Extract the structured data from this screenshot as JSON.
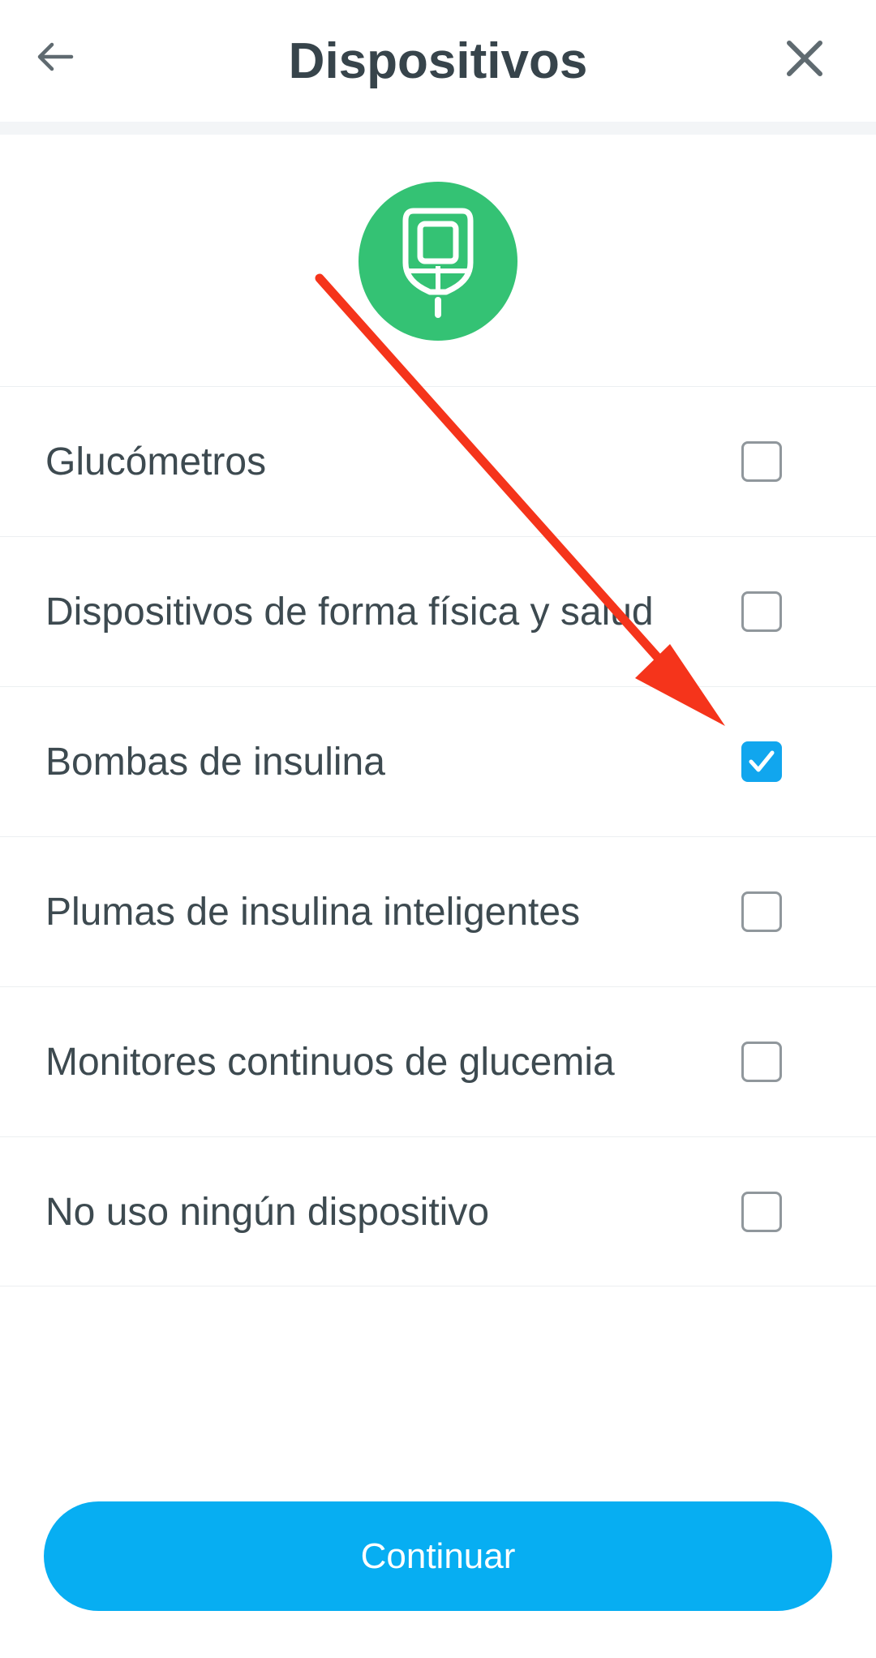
{
  "header": {
    "title": "Dispositivos",
    "back_icon": "arrow-left-icon",
    "close_icon": "close-icon"
  },
  "hero_icon": "glucometer-icon",
  "options": [
    {
      "label": "Glucómetros",
      "checked": false
    },
    {
      "label": "Dispositivos de forma física y salud",
      "checked": false
    },
    {
      "label": "Bombas de insulina",
      "checked": true
    },
    {
      "label": "Plumas de insulina inteligentes",
      "checked": false
    },
    {
      "label": "Monitores continuos de glucemia",
      "checked": false
    },
    {
      "label": "No uso ningún dispositivo",
      "checked": false
    }
  ],
  "continue_label": "Continuar",
  "colors": {
    "accent": "#07aef2",
    "checkbox_checked": "#11a6ee",
    "hero_bg": "#34c274",
    "annotation_arrow": "#f5341b"
  }
}
